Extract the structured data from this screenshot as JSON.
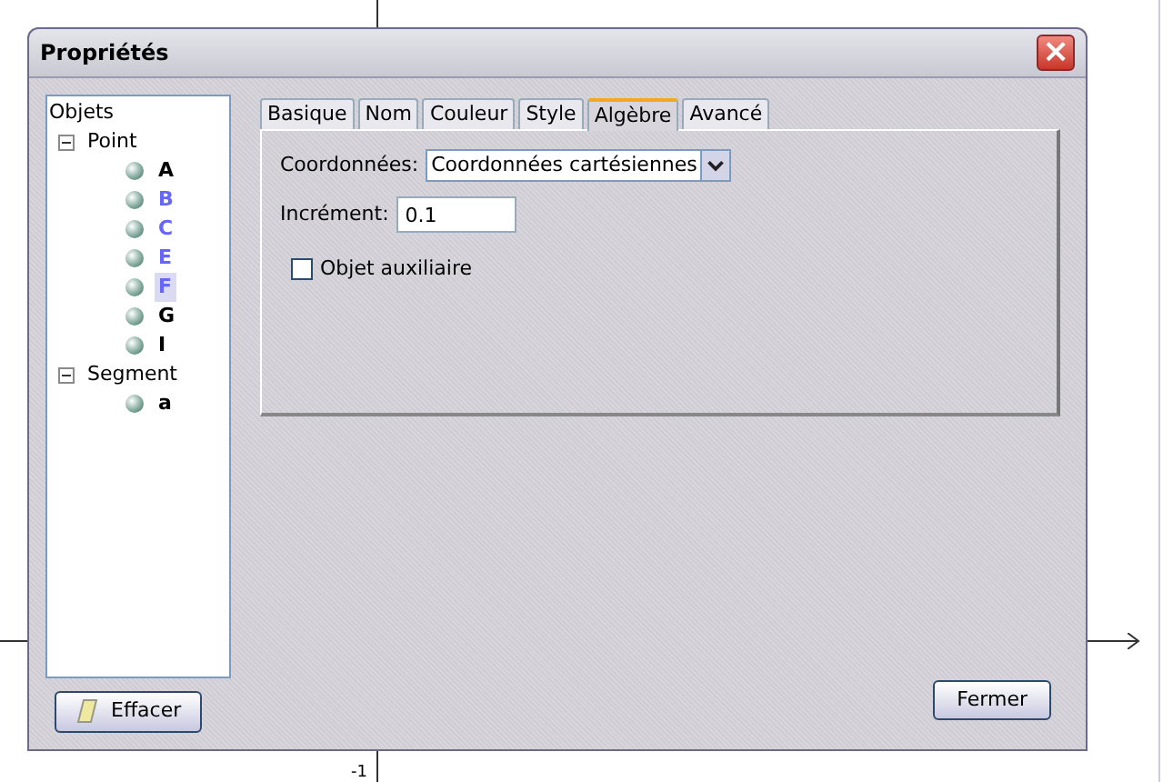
{
  "background": {
    "axis_label": "-1"
  },
  "window": {
    "title": "Propriétés",
    "close": "×"
  },
  "tree": {
    "root": "Objets",
    "items": [
      {
        "label": "Point",
        "expanded": true,
        "children": [
          {
            "label": "A",
            "color": "#000000",
            "selected": false
          },
          {
            "label": "B",
            "color": "#6666ff",
            "selected": false
          },
          {
            "label": "C",
            "color": "#6666ff",
            "selected": false
          },
          {
            "label": "E",
            "color": "#6666ff",
            "selected": false
          },
          {
            "label": "F",
            "color": "#6666ff",
            "selected": true
          },
          {
            "label": "G",
            "color": "#000000",
            "selected": false
          },
          {
            "label": "I",
            "color": "#000000",
            "selected": false
          }
        ]
      },
      {
        "label": "Segment",
        "expanded": true,
        "children": [
          {
            "label": "a",
            "color": "#000000",
            "selected": false
          }
        ]
      }
    ]
  },
  "tabs": [
    {
      "label": "Basique",
      "selected": false
    },
    {
      "label": "Nom",
      "selected": false
    },
    {
      "label": "Couleur",
      "selected": false
    },
    {
      "label": "Style",
      "selected": false
    },
    {
      "label": "Algèbre",
      "selected": true
    },
    {
      "label": "Avancé",
      "selected": false
    }
  ],
  "form": {
    "coordinates_label": "Coordonnées:",
    "coordinates_value": "Coordonnées cartésiennes",
    "increment_label": "Incrément:",
    "increment_value": "0.1",
    "auxiliary": {
      "label": "Objet auxiliaire",
      "checked": false
    }
  },
  "buttons": {
    "clear": "Effacer",
    "close": "Fermer"
  }
}
